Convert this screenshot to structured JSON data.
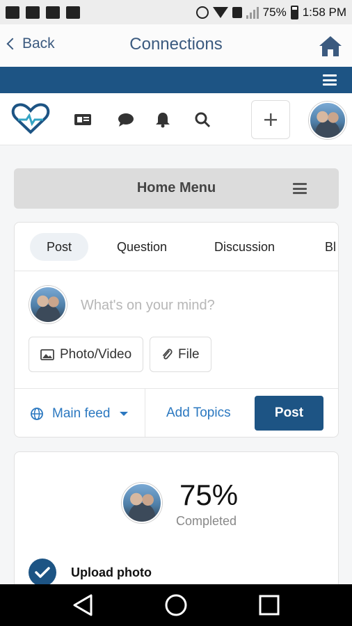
{
  "status_bar": {
    "battery": "75%",
    "time": "1:58 PM"
  },
  "app_bar": {
    "back_label": "Back",
    "title": "Connections"
  },
  "home_menu": {
    "label": "Home Menu"
  },
  "composer": {
    "tabs": [
      "Post",
      "Question",
      "Discussion",
      "Bl"
    ],
    "placeholder": "What's on your mind?",
    "photo_video_label": "Photo/Video",
    "file_label": "File",
    "feed_label": "Main feed",
    "add_topics_label": "Add Topics",
    "post_label": "Post"
  },
  "progress": {
    "percent": "75%",
    "completed_label": "Completed",
    "task_label": "Upload photo"
  },
  "colors": {
    "brand": "#1d5484",
    "link": "#2b78c0",
    "title": "#3b5a7f"
  }
}
